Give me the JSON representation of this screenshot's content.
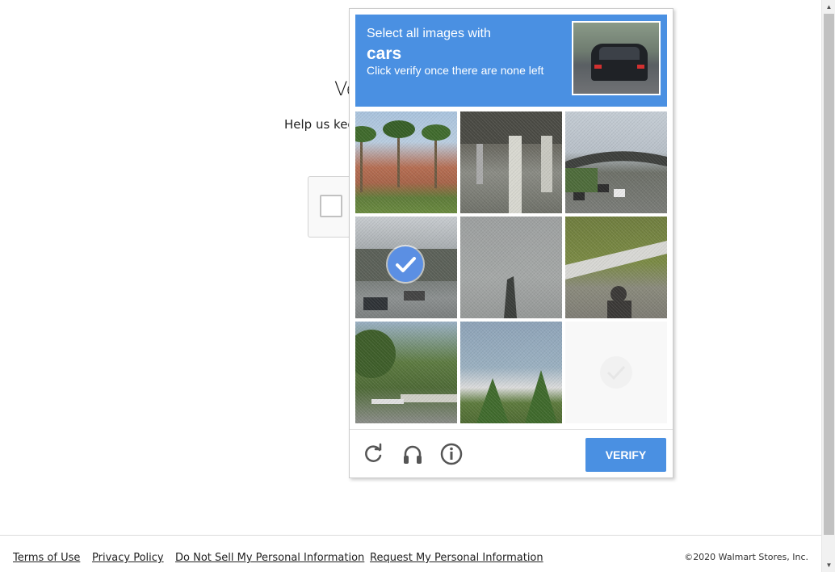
{
  "page": {
    "title": "Ve",
    "subtitle": "Help us kee"
  },
  "captcha": {
    "header_line1": "Select all images with",
    "keyword": "cars",
    "header_line3": "Click verify once there are none left",
    "accent_color": "#4a90e2",
    "tiles": [
      {
        "index": 1,
        "scene": "palm trees and building",
        "selected": false
      },
      {
        "index": 2,
        "scene": "under overpass pillars",
        "selected": false
      },
      {
        "index": 3,
        "scene": "highway overpass with cars",
        "selected": false
      },
      {
        "index": 4,
        "scene": "road with cars",
        "selected": true
      },
      {
        "index": 5,
        "scene": "sky with pole",
        "selected": false
      },
      {
        "index": 6,
        "scene": "bridge railing with shadow",
        "selected": false
      },
      {
        "index": 7,
        "scene": "trees and street",
        "selected": false
      },
      {
        "index": 8,
        "scene": "trees and sky",
        "selected": false
      },
      {
        "index": 9,
        "scene": "blank (fading)",
        "selected": false
      }
    ],
    "verify_label": "VERIFY",
    "icons": [
      "reload-icon",
      "audio-icon",
      "info-icon"
    ]
  },
  "footer": {
    "links": [
      "Terms of Use ",
      "Privacy Policy ",
      "Do Not Sell My Personal Information ",
      "Request My Personal Information"
    ],
    "copyright": "©2020 Walmart Stores, Inc."
  }
}
